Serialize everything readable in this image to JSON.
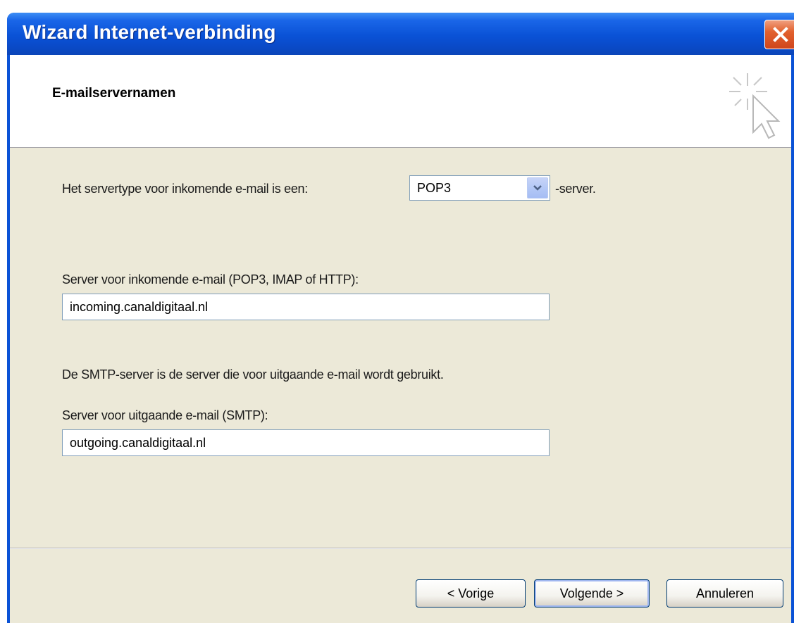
{
  "window": {
    "title": "Wizard Internet-verbinding",
    "close_icon": "close-x-icon"
  },
  "header": {
    "title": "E-mailservernamen",
    "icon": "wizard-cursor-icon"
  },
  "server_type": {
    "prefix": "Het servertype voor inkomende e-mail is een:",
    "selected": "POP3",
    "suffix": "-server."
  },
  "incoming": {
    "label": "Server voor inkomende e-mail (POP3, IMAP of HTTP):",
    "value": "incoming.canaldigitaal.nl"
  },
  "smtp_info": "De SMTP-server is de server die voor uitgaande e-mail wordt gebruikt.",
  "outgoing": {
    "label": "Server voor uitgaande e-mail (SMTP):",
    "value": "outgoing.canaldigitaal.nl"
  },
  "buttons": {
    "back": "< Vorige",
    "next": "Volgende >",
    "cancel": "Annuleren"
  },
  "colors": {
    "titlebar": "#0a52d6",
    "client": "#ece9d8",
    "close": "#d0461c"
  }
}
